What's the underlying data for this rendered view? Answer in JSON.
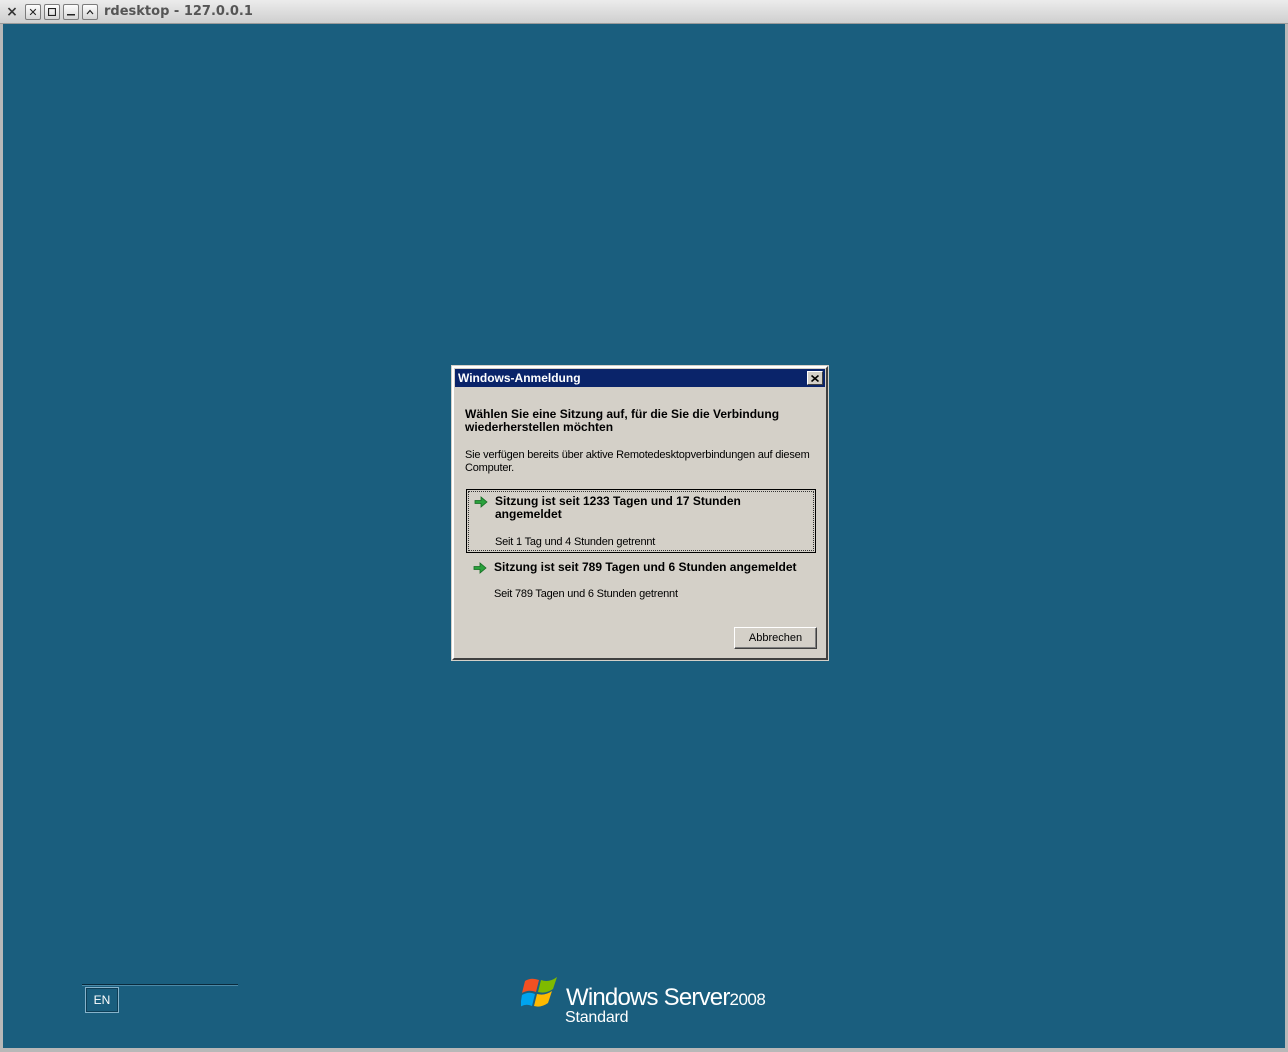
{
  "window": {
    "title": "rdesktop - 127.0.0.1",
    "menu_icon": "window-menu-icon",
    "close_icon": "close-icon",
    "maximize_icon": "maximize-icon",
    "minimize_icon": "minimize-icon",
    "shade_icon": "shade-icon"
  },
  "dialog": {
    "title": "Windows-Anmeldung",
    "heading": "Wählen Sie eine Sitzung auf, für die Sie die Verbindung wiederherstellen möchten",
    "description": "Sie verfügen bereits über aktive Remotedesktopverbindungen auf diesem Computer.",
    "sessions": [
      {
        "title": "Sitzung ist seit 1233 Tagen und 17 Stunden angemeldet",
        "subtitle": "Seit 1 Tag und 4 Stunden getrennt",
        "selected": true,
        "icon": "green-arrow-icon"
      },
      {
        "title": "Sitzung ist seit 789 Tagen und 6 Stunden angemeldet",
        "subtitle": "Seit 789 Tagen und 6 Stunden getrennt",
        "selected": false,
        "icon": "green-arrow-icon"
      }
    ],
    "cancel_label": "Abbrechen"
  },
  "language_bar": {
    "label": "EN"
  },
  "branding": {
    "name": "Windows Server",
    "version": "2008",
    "edition": "Standard"
  },
  "colors": {
    "desktop_background": "#1a5e7e",
    "dialog_title_bar": "#0a246a",
    "dialog_face": "#d4d0c8",
    "arrow_green": "#2aa13c"
  }
}
